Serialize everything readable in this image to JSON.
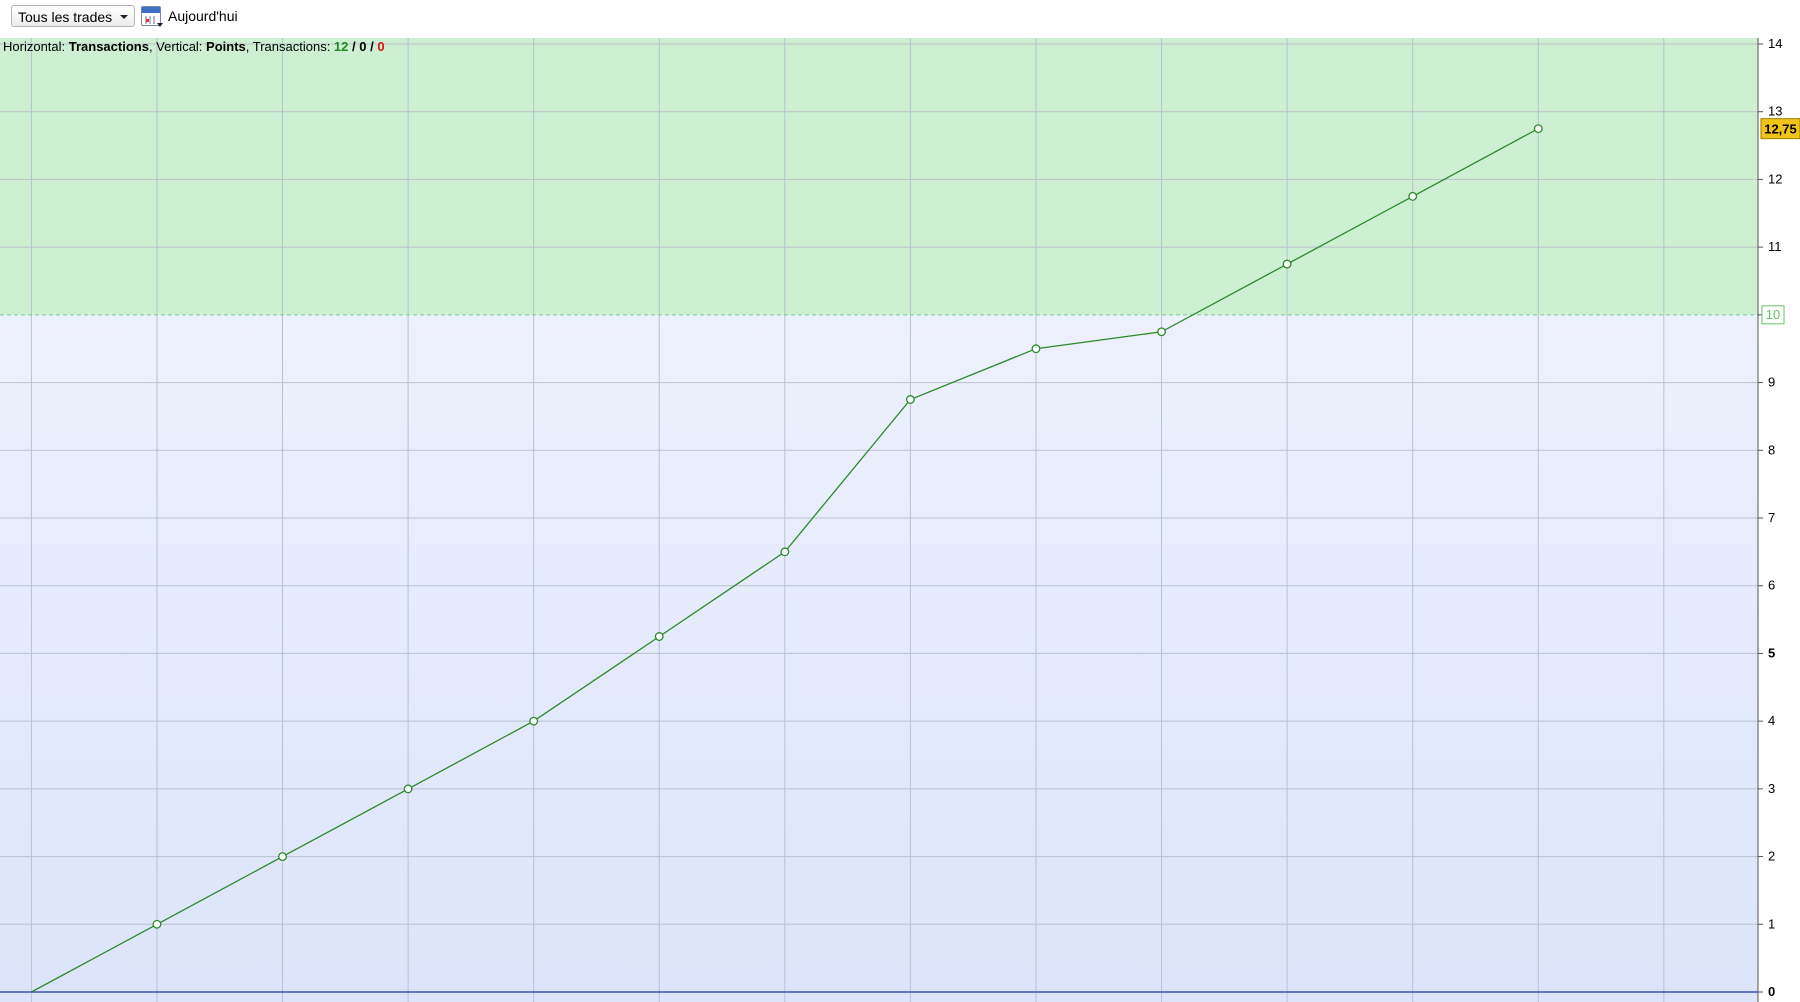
{
  "toolbar": {
    "filter_label": "Tous les trades",
    "calendar_icon": "calendar-icon",
    "date_label": "Aujourd'hui"
  },
  "info": {
    "h_prefix": "Horizontal: ",
    "h_value": "Transactions",
    "v_prefix": ", Vertical: ",
    "v_value": "Points",
    "t_prefix": ", Transactions: ",
    "t_green": "12",
    "sep1": " / ",
    "t_black": "0",
    "sep2": " / ",
    "t_red": "0"
  },
  "colors": {
    "line": "#2a8a2a",
    "zone_green": "#cdf0d2",
    "bg_top": "#f4f6fd",
    "bg_bottom": "#dce4fb",
    "zero_line": "#3d52b5",
    "grid": "#b9c0d0",
    "last_badge": "#f2c417",
    "target_badge": "#63c463"
  },
  "chart_data": {
    "type": "line",
    "x": [
      0,
      1,
      2,
      3,
      4,
      5,
      6,
      7,
      8,
      9,
      10,
      11,
      12
    ],
    "values": [
      0,
      1,
      2,
      3,
      4,
      5.25,
      6.5,
      8.75,
      9.5,
      9.75,
      10.75,
      11.75,
      12.75
    ],
    "ylim": [
      0,
      14
    ],
    "xlim": [
      -0.25,
      13.75
    ],
    "yticks": [
      "0",
      "1",
      "2",
      "3",
      "4",
      "5",
      "6",
      "7",
      "8",
      "9",
      "10",
      "11",
      "12",
      "13",
      "14"
    ],
    "bold_ticks": [
      "0",
      "5"
    ],
    "target_label": "10",
    "last_label": "12,75",
    "grid": true
  }
}
